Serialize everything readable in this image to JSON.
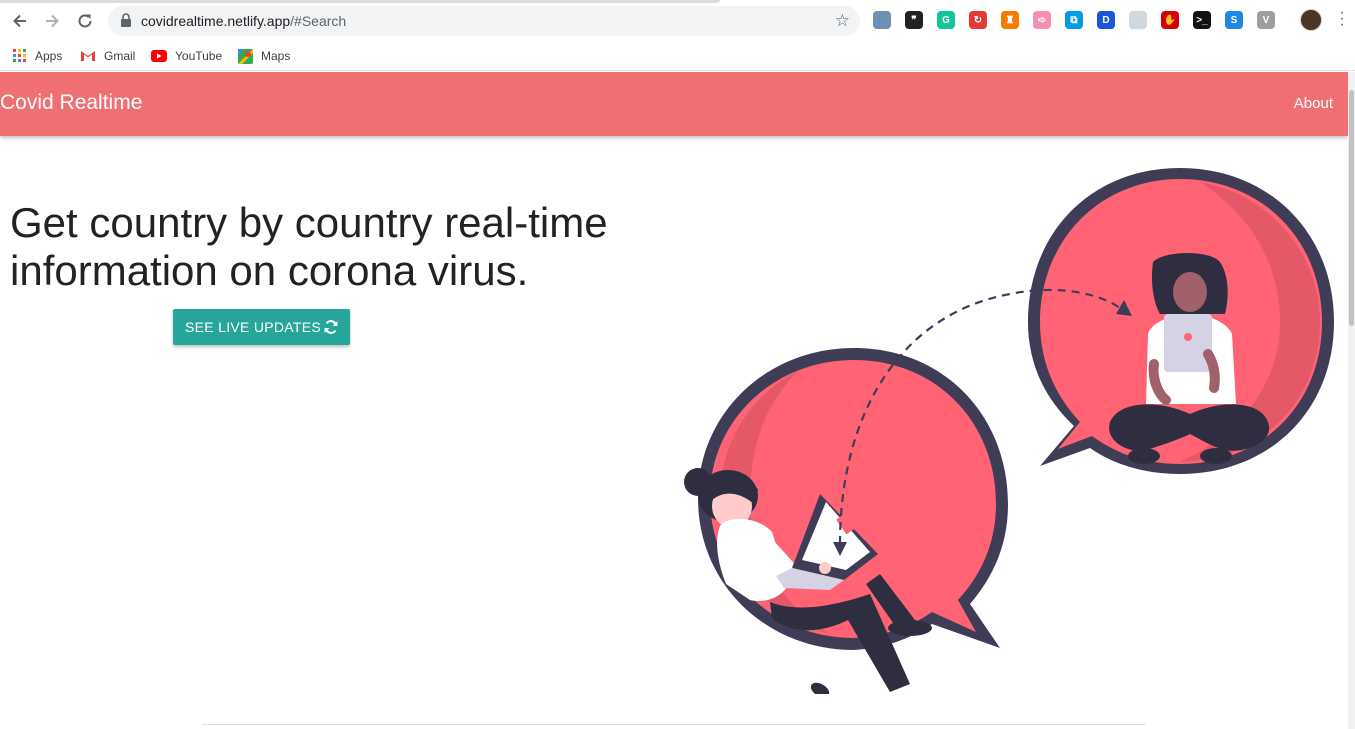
{
  "browser": {
    "url_host": "covidrealtime.netlify.app",
    "url_path": "/#Search",
    "bookmarks": [
      "Apps",
      "Gmail",
      "YouTube",
      "Maps"
    ],
    "extensions": [
      {
        "icon": "compass-ext-icon",
        "color": "#6f8fb5",
        "glyph": ""
      },
      {
        "icon": "quote-ext-icon",
        "color": "#202124",
        "glyph": "❞"
      },
      {
        "icon": "grammarly-ext-icon",
        "color": "#15c39a",
        "glyph": "G"
      },
      {
        "icon": "red-circle-ext-icon",
        "color": "#e53935",
        "glyph": "↻"
      },
      {
        "icon": "pocket-ext-icon",
        "color": "#f57c00",
        "glyph": "♜"
      },
      {
        "icon": "arrow-ext-icon",
        "color": "#f48fb1",
        "glyph": "➪"
      },
      {
        "icon": "copy-ext-icon",
        "color": "#039be5",
        "glyph": "⧉"
      },
      {
        "icon": "d-ext-icon",
        "color": "#1a56db",
        "glyph": "D"
      },
      {
        "icon": "grid-ext-icon",
        "color": "#cfd8dc",
        "glyph": ""
      },
      {
        "icon": "hand-ext-icon",
        "color": "#d50000",
        "glyph": "✋"
      },
      {
        "icon": "terminal-ext-icon",
        "color": "#111111",
        "glyph": ">_"
      },
      {
        "icon": "s-ext-icon",
        "color": "#1e88e5",
        "glyph": "S"
      },
      {
        "icon": "v-ext-icon",
        "color": "#9e9e9e",
        "glyph": "V"
      }
    ]
  },
  "app": {
    "brand": "Covid Realtime",
    "nav_about": "About",
    "headline": "Get country by country real-time information on corona virus.",
    "cta_label": "SEE LIVE UPDATES"
  },
  "colors": {
    "appbar": "#ef6f72",
    "cta": "#26a69a",
    "bubble": "#ff6374",
    "bubble_outline": "#3f3d56"
  }
}
